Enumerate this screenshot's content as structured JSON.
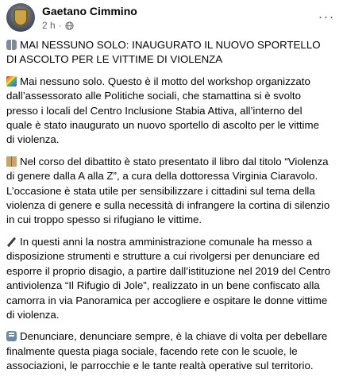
{
  "post": {
    "author": "Gaetano Cimmino",
    "time": "2 h",
    "audience_icon": "globe-icon",
    "more_icon": "more-options-icon",
    "more_label": "···"
  },
  "content": {
    "headline_emoji": "people-icon",
    "headline": "MAI NESSUNO SOLO: INAUGURATO IL NUOVO SPORTELLO DI ASCOLTO PER LE VITTIME DI VIOLENZA",
    "paragraphs": [
      {
        "emoji": "rainbow-flag-icon",
        "text": "Mai nessuno solo. Questo è il motto del workshop organizzato dall’assessorato alle Politiche sociali, che stamattina si è svolto presso i locali del Centro Inclusione Stabia Attiva, all’interno del quale è stato inaugurato un nuovo sportello di ascolto per le vittime di violenza."
      },
      {
        "emoji": "book-icon",
        "text": "Nel corso del dibattito è stato presentato il libro dal titolo “Violenza di genere dalla A alla Z”, a cura della dottoressa Virginia Ciaravolo. L’occasione è stata utile per sensibilizzare i cittadini sul tema della violenza di genere e sulla necessità di infrangere la cortina di silenzio in cui troppo spesso si rifugiano le vittime."
      },
      {
        "emoji": "pen-icon",
        "text": "In questi anni la nostra amministrazione comunale ha messo a disposizione strumenti e strutture a cui rivolgersi per denunciare ed esporre il proprio disagio, a partire dall’istituzione nel 2019 del Centro antiviolenza “Il Rifugio di Jole”, realizzato in un bene confiscato alla camorra in via Panoramica per accogliere e ospitare le donne vittime di violenza."
      },
      {
        "emoji": "speech-icon",
        "text": "Denunciare, denunciare sempre, è la chiave di volta per debellare finalmente questa piaga sociale, facendo rete con le scuole, le associazioni, le parrocchie e le tante realtà operative sul territorio."
      }
    ]
  }
}
